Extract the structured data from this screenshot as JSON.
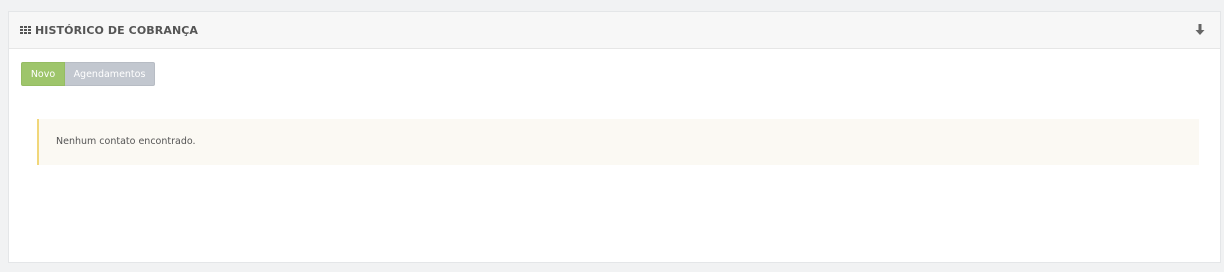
{
  "panel": {
    "title": "HISTÓRICO DE COBRANÇA",
    "header_icon": "grid-icon",
    "collapse_icon": "arrow-down-icon"
  },
  "tabs": [
    {
      "label": "Novo",
      "active": true,
      "color": "#9ec56b"
    },
    {
      "label": "Agendamentos",
      "active": false,
      "color": "#c2c7cf"
    }
  ],
  "alert": {
    "message": "Nenhum contato encontrado.",
    "accent_color": "#f1d77a",
    "background": "#fbf9f3"
  }
}
